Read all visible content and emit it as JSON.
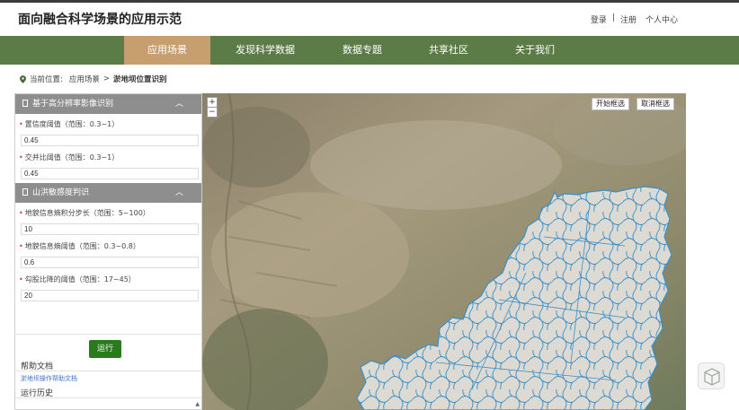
{
  "header": {
    "site_title": "面向融合科学场景的应用示范",
    "login": "登录",
    "separator": "|",
    "register": "注册",
    "user_center": "个人中心"
  },
  "nav": {
    "items": [
      {
        "label": "应用场景",
        "active": true
      },
      {
        "label": "发现科学数据",
        "active": false
      },
      {
        "label": "数据专题",
        "active": false
      },
      {
        "label": "共享社区",
        "active": false
      },
      {
        "label": "关于我们",
        "active": false
      }
    ]
  },
  "breadcrumb": {
    "prefix": "当前位置:",
    "level1": "应用场景",
    "separator": ">",
    "current": "淤地坝位置识别"
  },
  "panel": {
    "section1": {
      "title": "基于高分辨率影像识别",
      "fields": [
        {
          "label": "置信度阈值（范围：0.3~1）",
          "value": "0.45"
        },
        {
          "label": "交并比阈值（范围：0.3~1）",
          "value": "0.45"
        }
      ]
    },
    "section2": {
      "title": "山洪敏感度判识",
      "fields": [
        {
          "label": "地貌信息熵积分步长（范围：5~100）",
          "value": "10"
        },
        {
          "label": "地貌信息熵阈值（范围：0.3~0.8）",
          "value": "0.6"
        },
        {
          "label": "勾股比降的阈值（范围：17~45）",
          "value": "20"
        }
      ]
    },
    "run_button": "运行",
    "help_title": "帮助文档",
    "help_link": "淤地坝操作帮助文档",
    "history_title": "运行历史"
  },
  "map": {
    "zoom_in": "+",
    "zoom_out": "−",
    "start_select": "开始框选",
    "cancel_select": "取消框选"
  },
  "colors": {
    "nav_bg": "#5c7c47",
    "nav_active": "#c79f6e",
    "run_button": "#2a7a1e",
    "river": "#3a8fc7"
  }
}
